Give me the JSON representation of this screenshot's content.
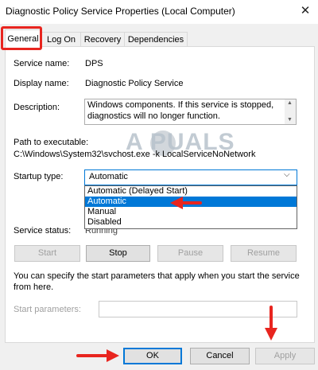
{
  "window": {
    "title": "Diagnostic Policy Service Properties (Local Computer)",
    "close_glyph": "✕"
  },
  "tabs": [
    {
      "label": "General",
      "active": true
    },
    {
      "label": "Log On"
    },
    {
      "label": "Recovery"
    },
    {
      "label": "Dependencies"
    }
  ],
  "general": {
    "service_name_label": "Service name:",
    "service_name_value": "DPS",
    "display_name_label": "Display name:",
    "display_name_value": "Diagnostic Policy Service",
    "description_label": "Description:",
    "description_value": "Windows components.  If this service is stopped, diagnostics will no longer function.",
    "path_label": "Path to executable:",
    "path_value": "C:\\Windows\\System32\\svchost.exe -k LocalServiceNoNetwork",
    "startup_type_label": "Startup type:",
    "startup_type_value": "Automatic",
    "startup_options": [
      "Automatic (Delayed Start)",
      "Automatic",
      "Manual",
      "Disabled"
    ],
    "service_status_label": "Service status:",
    "service_status_value": "Running",
    "start_label": "Start",
    "stop_label": "Stop",
    "pause_label": "Pause",
    "resume_label": "Resume",
    "info_text": "You can specify the start parameters that apply when you start the service from here.",
    "start_params_label": "Start parameters:",
    "start_params_value": ""
  },
  "footer": {
    "ok_label": "OK",
    "cancel_label": "Cancel",
    "apply_label": "Apply"
  },
  "watermark": "A PUALS",
  "colors": {
    "accent": "#0078d7",
    "highlight_red": "#e8251f"
  }
}
